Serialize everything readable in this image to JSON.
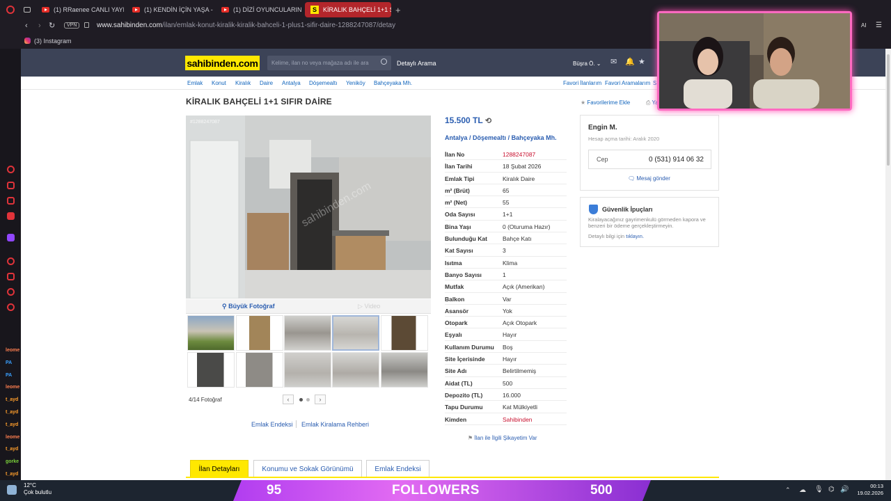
{
  "browser": {
    "tabs": [
      {
        "label": "(1) RRaenee CANLI YAYINI"
      },
      {
        "label": "(1) KENDİN İÇİN YAŞA - Yo"
      },
      {
        "label": "(1) DİZİ OYUNCULARININ"
      },
      {
        "label": "KİRALIK BAHÇELİ 1+1 SIFIR"
      }
    ],
    "vpn_label": "VPN",
    "url_host": "www.sahibinden.com",
    "url_path": "/ilan/emlak-konut-kiralik-kiralik-bahceli-1-plus1-sifir-daire-1288247087/detay",
    "bookmark": "(3) Instagram",
    "ai_label": "AI"
  },
  "site": {
    "logo": "sahibinden.com",
    "search_placeholder": "Kelime, ilan no veya mağaza adı ile ara",
    "detailed_search": "Detaylı Arama",
    "user": "Büşra Ö."
  },
  "breadcrumbs": [
    "Emlak",
    "Konut",
    "Kiralık",
    "Daire",
    "Antalya",
    "Döşemealtı",
    "Yeniköy",
    "Bahçeyaka Mh."
  ],
  "top_links": [
    "Favori İlanlarım",
    "Favori Aramalarım",
    "S"
  ],
  "listing": {
    "title": "KİRALIK BAHÇELİ 1+1 SIFIR DAİRE",
    "add_favorite": "Favorilerime Ekle",
    "print": "Ya",
    "photo_id": "#1288247087",
    "big_photo": "Büyük Fotoğraf",
    "video": "Video",
    "photo_count": "4/14 Fotoğraf",
    "price": "15.500 TL",
    "location": [
      "Antalya",
      "Döşemealtı",
      "Bahçeyaka Mh."
    ],
    "properties": [
      {
        "k": "İlan No",
        "v": "1288247087"
      },
      {
        "k": "İlan Tarihi",
        "v": "18 Şubat 2026"
      },
      {
        "k": "Emlak Tipi",
        "v": "Kiralık Daire"
      },
      {
        "k": "m² (Brüt)",
        "v": "65"
      },
      {
        "k": "m² (Net)",
        "v": "55"
      },
      {
        "k": "Oda Sayısı",
        "v": "1+1"
      },
      {
        "k": "Bina Yaşı",
        "v": "0 (Oturuma Hazır)"
      },
      {
        "k": "Bulunduğu Kat",
        "v": "Bahçe Katı"
      },
      {
        "k": "Kat Sayısı",
        "v": "3"
      },
      {
        "k": "Isıtma",
        "v": "Klima"
      },
      {
        "k": "Banyo Sayısı",
        "v": "1"
      },
      {
        "k": "Mutfak",
        "v": "Açık (Amerikan)"
      },
      {
        "k": "Balkon",
        "v": "Var"
      },
      {
        "k": "Asansör",
        "v": "Yok"
      },
      {
        "k": "Otopark",
        "v": "Açık Otopark"
      },
      {
        "k": "Eşyalı",
        "v": "Hayır"
      },
      {
        "k": "Kullanım Durumu",
        "v": "Boş"
      },
      {
        "k": "Site İçerisinde",
        "v": "Hayır"
      },
      {
        "k": "Site Adı",
        "v": "Belirtilmemiş"
      },
      {
        "k": "Aidat (TL)",
        "v": "500"
      },
      {
        "k": "Depozito (TL)",
        "v": "16.000"
      },
      {
        "k": "Tapu Durumu",
        "v": "Kat Mülkiyetli"
      },
      {
        "k": "Kimden",
        "v": "Sahibinden"
      }
    ],
    "complain": "İlan ile İlgili Şikayetim Var",
    "links": [
      "Emlak Endeksi",
      "Emlak Kiralama Rehberi"
    ]
  },
  "seller": {
    "name": "Engin M.",
    "since": "Hesap açma tarihi: Aralık 2020",
    "phone_label": "Cep",
    "phone": "0 (531) 914 06 32",
    "message": "Mesaj gönder"
  },
  "safety": {
    "title": "Güvenlik İpuçları",
    "text": "Kiralayacağınız gayrimenkulü görmeden kapora ve benzeri bir ödeme gerçekleştirmeyin.",
    "detail": "Detaylı bilgi için",
    "detail_link": "tıklayın."
  },
  "bottom_tabs": [
    "İlan Detayları",
    "Konumu ve Sokak Görünümü",
    "Emlak Endeksi"
  ],
  "chat_names": [
    "leome",
    "PA",
    "PA",
    "leome",
    "t_ayd",
    "t_ayd",
    "t_ayd",
    "leome",
    "t_ayd",
    "gorke",
    "t_ayd",
    "kiralad",
    "leome",
    "PA"
  ],
  "taskbar": {
    "temp": "12°C",
    "weather": "Çok bulutlu",
    "overlay_left": "95",
    "overlay_mid": "FOLLOWERS",
    "overlay_right": "500",
    "time": "00:13",
    "date": "19.02.2026"
  }
}
